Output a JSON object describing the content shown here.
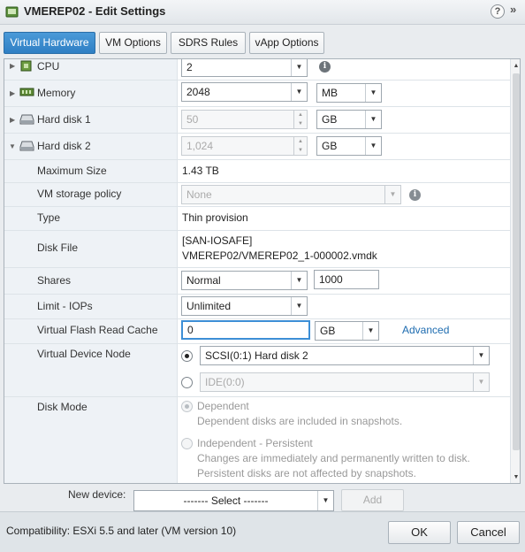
{
  "window": {
    "title": "VMEREP02 - Edit Settings",
    "help_label": "?",
    "expand_label": "»"
  },
  "tabs": [
    {
      "label": "Virtual Hardware",
      "active": true
    },
    {
      "label": "VM Options",
      "active": false
    },
    {
      "label": "SDRS Rules",
      "active": false
    },
    {
      "label": "vApp Options",
      "active": false
    }
  ],
  "hardware": {
    "cpu": {
      "label": "CPU",
      "value": "2"
    },
    "memory": {
      "label": "Memory",
      "value": "2048",
      "unit": "MB"
    },
    "hard_disk_1": {
      "label": "Hard disk 1",
      "value": "50",
      "unit": "GB"
    },
    "hard_disk_2": {
      "label": "Hard disk 2",
      "value": "1,024",
      "unit": "GB",
      "max_size": {
        "label": "Maximum Size",
        "value": "1.43 TB"
      },
      "storage_policy": {
        "label": "VM storage policy",
        "value": "None"
      },
      "type": {
        "label": "Type",
        "value": "Thin provision"
      },
      "disk_file": {
        "label": "Disk File",
        "line1": "[SAN-IOSAFE]",
        "line2": "VMEREP02/VMEREP02_1-000002.vmdk"
      },
      "shares": {
        "label": "Shares",
        "value": "Normal",
        "amount": "1000"
      },
      "limit_iops": {
        "label": "Limit - IOPs",
        "value": "Unlimited"
      },
      "flash_cache": {
        "label": "Virtual Flash Read Cache",
        "value": "0",
        "unit": "GB",
        "advanced": "Advanced"
      },
      "device_node": {
        "label": "Virtual Device Node",
        "scsi": "SCSI(0:1) Hard disk 2",
        "ide": "IDE(0:0)"
      },
      "disk_mode": {
        "label": "Disk Mode",
        "dependent_title": "Dependent",
        "dependent_desc": "Dependent disks are included in snapshots.",
        "independent_title": "Independent - Persistent",
        "independent_desc1": "Changes are immediately and permanently written to disk.",
        "independent_desc2": "Persistent disks are not affected by snapshots."
      }
    }
  },
  "new_device": {
    "label": "New device:",
    "select": "------- Select -------",
    "add": "Add"
  },
  "footer": {
    "compatibility": "Compatibility: ESXi 5.5 and later (VM version 10)",
    "ok": "OK",
    "cancel": "Cancel"
  },
  "icons": [
    "vm-icon",
    "help-icon",
    "expand-icon",
    "cpu-icon",
    "memory-icon",
    "hard-disk-icon",
    "info-icon",
    "chevron-down-icon",
    "expand-arrow-icon",
    "collapse-arrow-icon"
  ],
  "colors": {
    "tab_active": "#3a8acd",
    "label_column": "#eef2f6",
    "link": "#1e6cb0",
    "focus": "#3d8fd6"
  }
}
